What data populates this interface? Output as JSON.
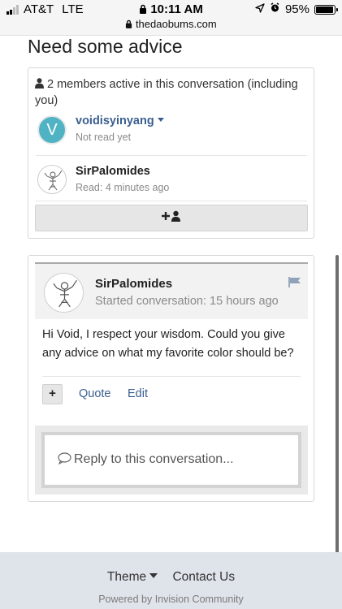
{
  "status_bar": {
    "carrier": "AT&T",
    "network": "LTE",
    "time": "10:11 AM",
    "url": "thedaobums.com",
    "battery": "95%",
    "battery_level": 0.95
  },
  "page": {
    "title": "Need some advice"
  },
  "participants": {
    "header": "2 members active in this conversation (including you)",
    "members": [
      {
        "name": "voidisyinyang",
        "status": "Not read yet",
        "avatar_letter": "V",
        "avatar_color": "#4fb3c4"
      },
      {
        "name": "SirPalomides",
        "status": "Read: 4 minutes ago"
      }
    ],
    "add_icon": "plus-user-icon"
  },
  "post": {
    "author": "SirPalomides",
    "meta": "Started conversation: 15 hours ago",
    "body": "Hi Void, I respect your wisdom. Could you give any advice on what my favorite color should be?",
    "actions": {
      "multiquote": "+",
      "quote": "Quote",
      "edit": "Edit"
    },
    "reply_placeholder": "Reply to this conversation..."
  },
  "footer": {
    "theme": "Theme",
    "contact": "Contact Us",
    "powered_by": "Powered by Invision Community"
  },
  "colors": {
    "link": "#3a5f8f",
    "footer_bg": "#dfe3ea"
  }
}
